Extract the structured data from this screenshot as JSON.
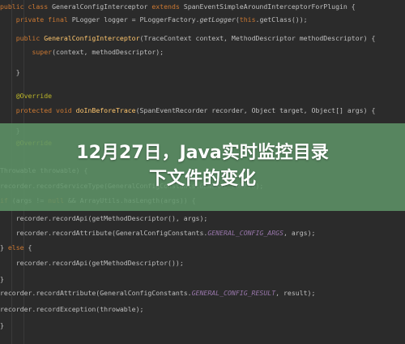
{
  "code": {
    "lines": [
      {
        "segments": [
          {
            "t": "public class ",
            "c": "kw"
          },
          {
            "t": "GeneralConfigInterceptor ",
            "c": ""
          },
          {
            "t": "extends ",
            "c": "kw"
          },
          {
            "t": "SpanEventSimpleAroundInterceptorForPlugin {",
            "c": ""
          }
        ]
      },
      {
        "segments": [
          {
            "t": "    private final ",
            "c": "kw"
          },
          {
            "t": "PLogger logger = PLoggerFactory.",
            "c": ""
          },
          {
            "t": "getLogger",
            "c": "itf"
          },
          {
            "t": "(",
            "c": ""
          },
          {
            "t": "this",
            "c": "kw"
          },
          {
            "t": ".getClass());",
            "c": ""
          }
        ]
      },
      {
        "segments": [
          {
            "t": "    public ",
            "c": "kw"
          },
          {
            "t": "GeneralConfigInterceptor",
            "c": "fn"
          },
          {
            "t": "(TraceContext context, MethodDescriptor methodDescriptor) {",
            "c": ""
          }
        ]
      },
      {
        "segments": [
          {
            "t": "        ",
            "c": ""
          },
          {
            "t": "super",
            "c": "kw"
          },
          {
            "t": "(context, methodDescriptor);",
            "c": ""
          }
        ]
      },
      {
        "segments": [
          {
            "t": "    }",
            "c": ""
          }
        ]
      },
      {
        "segments": [
          {
            "t": "    @Override",
            "c": "ann"
          }
        ]
      },
      {
        "segments": [
          {
            "t": "    protected void ",
            "c": "kw"
          },
          {
            "t": "doInBeforeTrace",
            "c": "fn"
          },
          {
            "t": "(SpanEventRecorder recorder, Object target, Object[] args) {",
            "c": ""
          }
        ]
      },
      {
        "segments": [
          {
            "t": "    }",
            "c": ""
          }
        ]
      },
      {
        "segments": [
          {
            "t": "    @Override",
            "c": "ann"
          }
        ]
      },
      {
        "segments": [
          {
            "t": "Throwable throwable) {",
            "c": ""
          }
        ]
      },
      {
        "segments": [
          {
            "t": "recorder.recordServiceType(GeneralConfigConstants.",
            "c": ""
          },
          {
            "t": "GENERAL_CONFIG",
            "c": "cst"
          },
          {
            "t": ");",
            "c": ""
          }
        ]
      },
      {
        "segments": [
          {
            "t": "if ",
            "c": "kw"
          },
          {
            "t": "(args != ",
            "c": ""
          },
          {
            "t": "null ",
            "c": "kw"
          },
          {
            "t": "&& ArrayUtils.hasLength(args)) {",
            "c": ""
          }
        ]
      },
      {
        "segments": [
          {
            "t": "    recorder.recordApi(getMethodDescriptor(), args);",
            "c": ""
          }
        ]
      },
      {
        "segments": [
          {
            "t": "    recorder.recordAttribute(GeneralConfigConstants.",
            "c": ""
          },
          {
            "t": "GENERAL_CONFIG_ARGS",
            "c": "cst"
          },
          {
            "t": ", args);",
            "c": ""
          }
        ]
      },
      {
        "segments": [
          {
            "t": "} ",
            "c": ""
          },
          {
            "t": "else ",
            "c": "kw"
          },
          {
            "t": "{",
            "c": ""
          }
        ]
      },
      {
        "segments": [
          {
            "t": "    recorder.recordApi(getMethodDescriptor());",
            "c": ""
          }
        ]
      },
      {
        "segments": [
          {
            "t": "}",
            "c": ""
          }
        ]
      },
      {
        "segments": [
          {
            "t": "recorder.recordAttribute(GeneralConfigConstants.",
            "c": ""
          },
          {
            "t": "GENERAL_CONFIG_RESULT",
            "c": "cst"
          },
          {
            "t": ", result);",
            "c": ""
          }
        ]
      },
      {
        "segments": [
          {
            "t": "recorder.recordException(throwable);",
            "c": ""
          }
        ]
      },
      {
        "segments": [
          {
            "t": "}",
            "c": ""
          }
        ]
      }
    ]
  },
  "banner": {
    "line1": "12月27日，Java实时监控目录",
    "line2": "下文件的变化"
  },
  "colors": {
    "background": "#2b2b2b",
    "keyword": "#cc7832",
    "annotation": "#bbb529",
    "method": "#ffc66d",
    "constant": "#9876aa",
    "banner": "#5e9468"
  }
}
